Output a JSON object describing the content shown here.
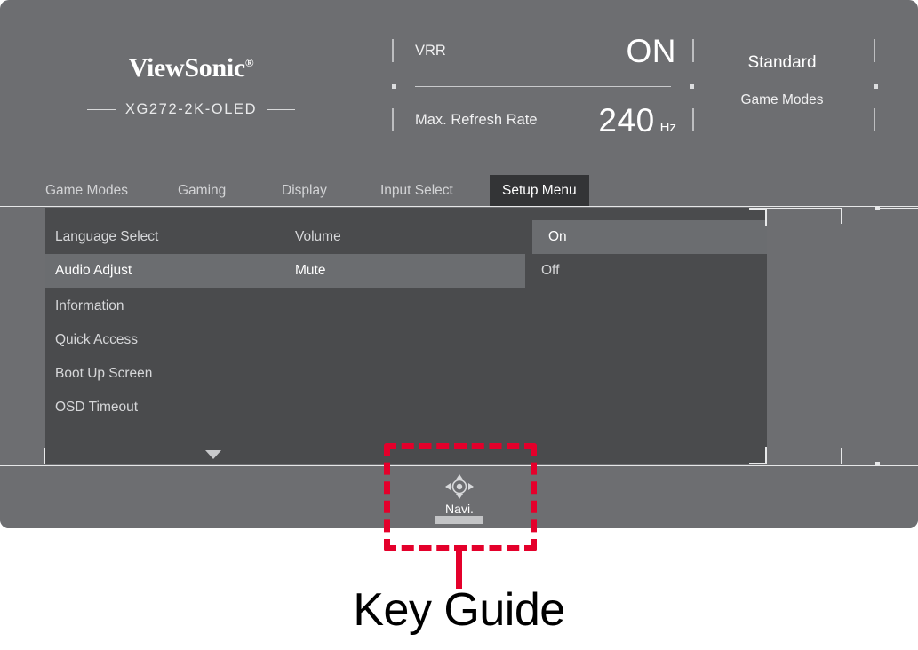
{
  "osd": {
    "brand": {
      "logo_text": "ViewSonic",
      "registered_mark": "®",
      "model": "XG272-2K-OLED"
    },
    "status": {
      "rows": [
        {
          "label": "VRR",
          "value": "ON",
          "unit": ""
        },
        {
          "label": "Max. Refresh Rate",
          "value": "240",
          "unit": "Hz"
        }
      ]
    },
    "mode": {
      "value": "Standard",
      "caption": "Game Modes"
    },
    "tabs": [
      {
        "label": "Game Modes",
        "active": false
      },
      {
        "label": "Gaming",
        "active": false
      },
      {
        "label": "Display",
        "active": false
      },
      {
        "label": "Input Select",
        "active": false
      },
      {
        "label": "Setup Menu",
        "active": true
      }
    ],
    "menu": {
      "column1": [
        {
          "label": "Language Select",
          "selected": false
        },
        {
          "label": "Audio Adjust",
          "selected": true
        },
        {
          "label": "Information",
          "selected": false
        },
        {
          "label": "Quick Access",
          "selected": false
        },
        {
          "label": "Boot Up Screen",
          "selected": false
        },
        {
          "label": "OSD Timeout",
          "selected": false
        }
      ],
      "column2": [
        {
          "label": "Volume",
          "selected": false
        },
        {
          "label": "Mute",
          "selected": true
        }
      ],
      "column3": [
        {
          "label": "On",
          "selected": true
        },
        {
          "label": "Off",
          "selected": false
        }
      ],
      "scroll_indicator": "chevron-down"
    },
    "key_guide": {
      "navi_label": "Navi.",
      "navi_icon": "joystick-navigate-icon"
    }
  },
  "annotation": {
    "caption": "Key Guide",
    "color": "#e4002b"
  },
  "colors": {
    "osd_background": "#6d6e71",
    "panel_background": "#4a4b4d",
    "row_highlight": "#6b6d70",
    "active_tab": "#333436",
    "text_primary": "#ffffff",
    "text_secondary": "#d3d4d6",
    "annotation_red": "#e4002b"
  }
}
